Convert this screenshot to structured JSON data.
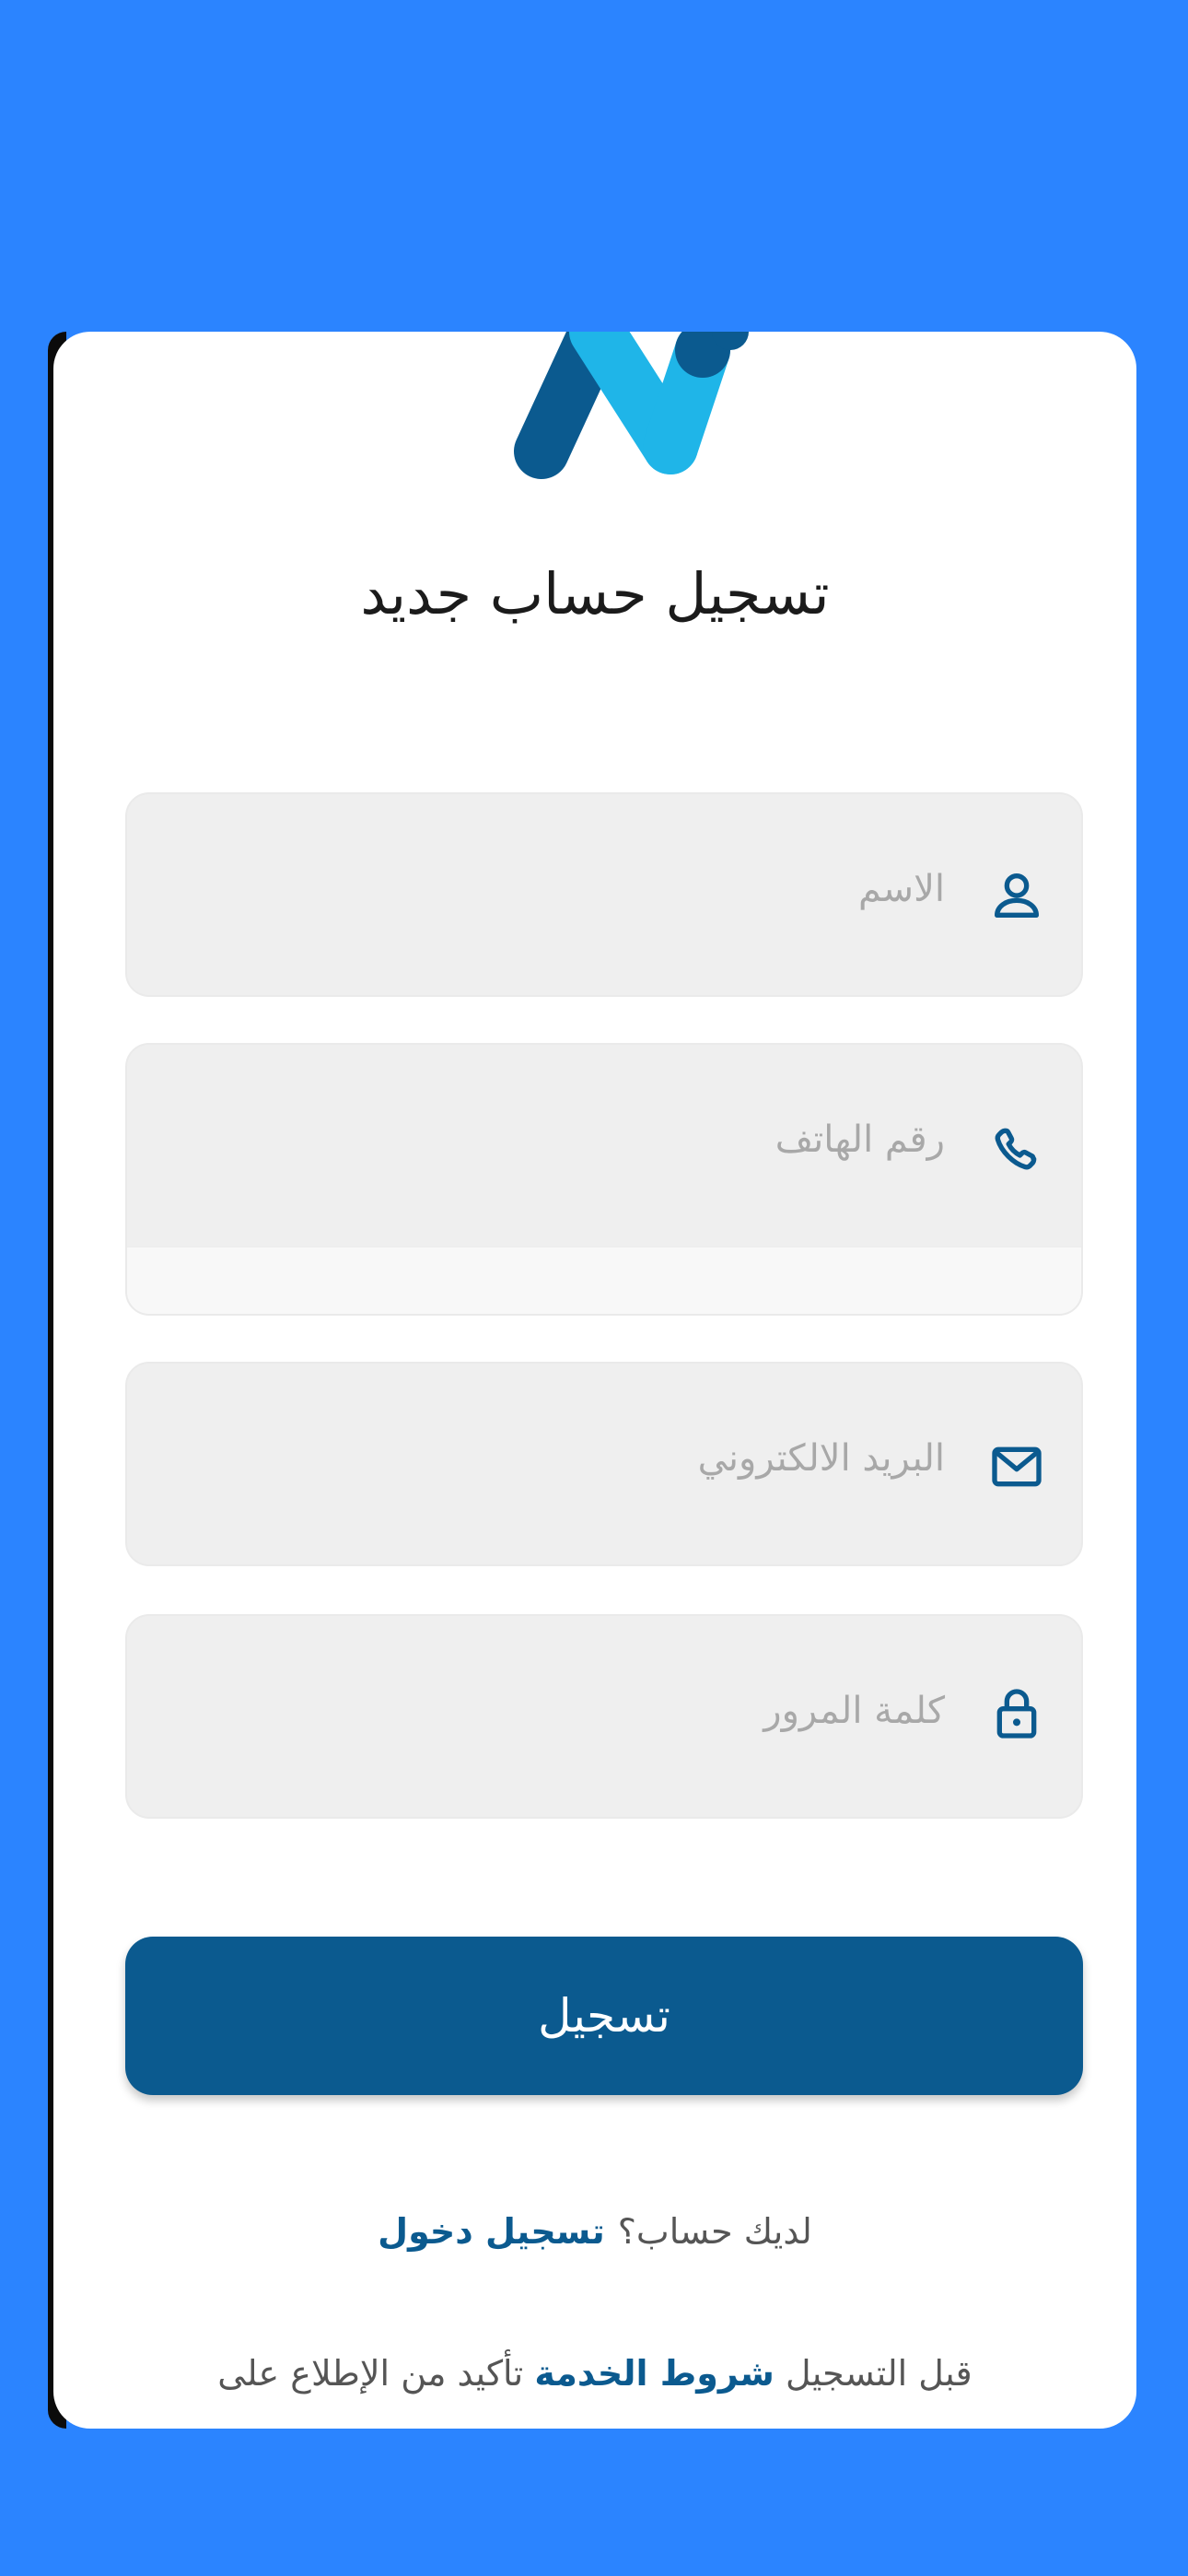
{
  "screen": {
    "title": "تسجيل حساب جديد",
    "background_color": "#2B84FF",
    "accent_color": "#0B5A8F"
  },
  "form": {
    "name_field": {
      "placeholder": "الاسم",
      "icon": "user-icon"
    },
    "phone_field": {
      "placeholder": "رقم الهاتف",
      "icon": "phone-icon"
    },
    "email_field": {
      "placeholder": "البريد الالكتروني",
      "icon": "mail-icon"
    },
    "password_field": {
      "placeholder": "كلمة المرور",
      "icon": "lock-icon"
    },
    "submit_label": "تسجيل"
  },
  "footer": {
    "have_account_text": "لديك حساب؟",
    "login_link": "تسجيل دخول",
    "terms_prefix": "قبل التسجيل",
    "terms_link": "شروط الخدمة",
    "terms_suffix": "تأكيد من الإطلاع على"
  }
}
